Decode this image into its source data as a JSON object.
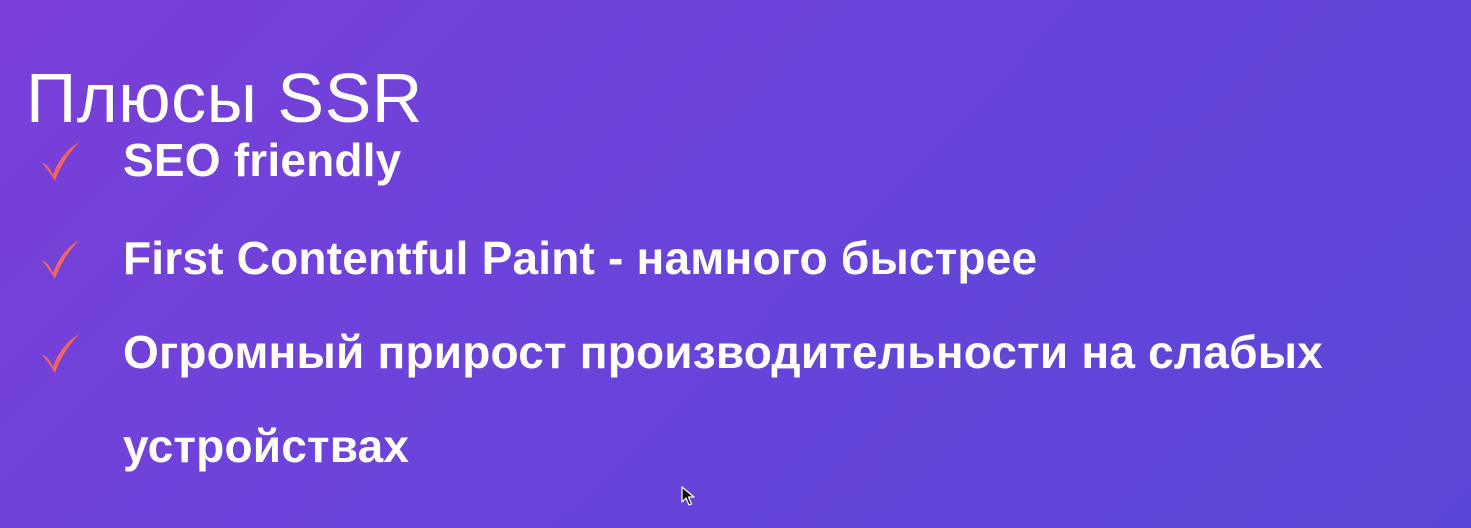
{
  "slide": {
    "title": "Плюсы SSR",
    "bullets": [
      {
        "icon": "check-icon",
        "text": "SEO friendly"
      },
      {
        "icon": "check-icon",
        "text": "First Contentful Paint - намного быстрее"
      },
      {
        "icon": "check-icon",
        "text": "Огромный прирост производительности на слабых устройствах"
      }
    ]
  },
  "colors": {
    "background_start": "#7a3fd8",
    "background_end": "#5a46d6",
    "text": "#ffffff",
    "check_accent": "#f2665f"
  }
}
